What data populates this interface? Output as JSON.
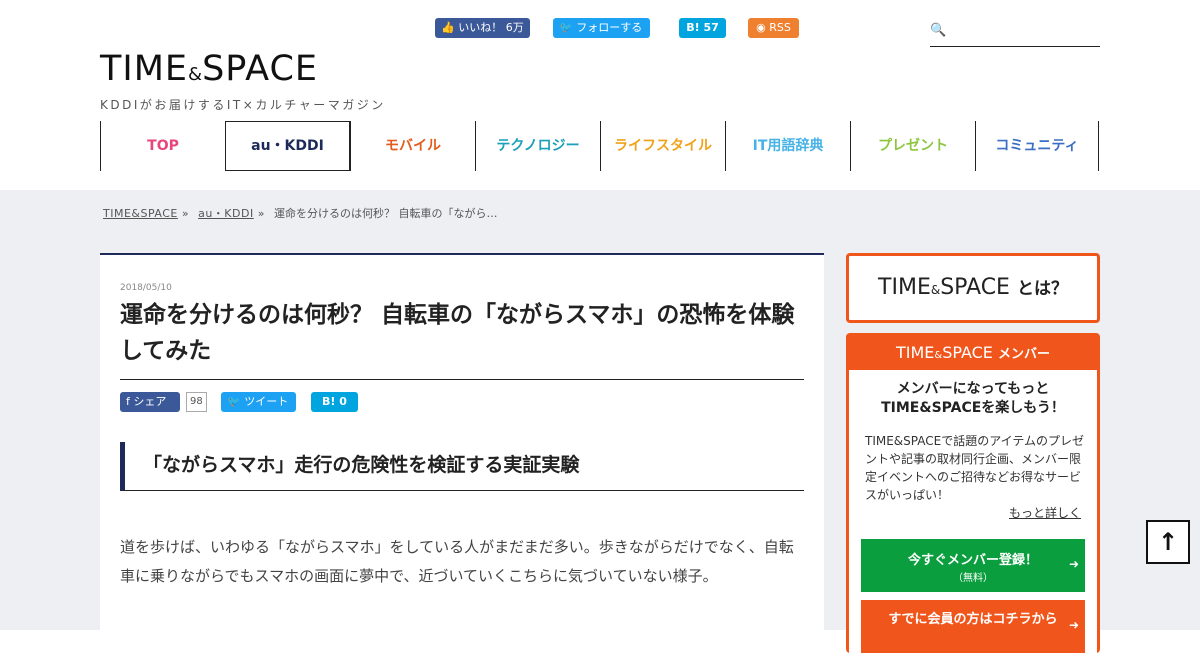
{
  "header": {
    "logo_main": "TIME",
    "logo_amp": "&",
    "logo_main2": "SPACE",
    "logo_tagline": "KDDIがお届けするIT×カルチャーマガジン",
    "social": [
      {
        "label": "👍 いいね！",
        "count": "6万",
        "color": "#3b5998"
      },
      {
        "label": "🐦 フォローする",
        "color": "#1da1f2"
      },
      {
        "label": "B! 57",
        "color": "#00a4de"
      },
      {
        "label": "RSS",
        "color": "#ee802f"
      }
    ],
    "search_placeholder": ""
  },
  "nav": [
    {
      "label": "TOP",
      "color": "#e8447d"
    },
    {
      "label": "au・KDDI",
      "color": "#1e2a5a",
      "active": true
    },
    {
      "label": "モバイル",
      "color": "#e25c1c"
    },
    {
      "label": "テクノロジー",
      "color": "#1aa0b9"
    },
    {
      "label": "ライフスタイル",
      "color": "#f0a31a"
    },
    {
      "label": "IT用語辞典",
      "color": "#47b2e6"
    },
    {
      "label": "プレゼント",
      "color": "#8cc63f"
    },
    {
      "label": "コミュニティ",
      "color": "#3b6fc4"
    }
  ],
  "breadcrumb": {
    "home": "TIME&SPACE",
    "cat": "au・KDDI",
    "current": "運命を分けるのは何秒？ 自転車の「ながら…",
    "sep": "»"
  },
  "article": {
    "date": "2018/05/10",
    "title": "運命を分けるのは何秒？ 自転車の「ながらスマホ」の恐怖を体験してみた",
    "share_fb": "f シェア",
    "share_fb_count": "98",
    "share_tw": "ツイート",
    "share_hb": "B! 0",
    "heading": "「ながらスマホ」走行の危険性を検証する実証実験",
    "body": "道を歩けば、いわゆる「ながらスマホ」をしている人がまだまだ多い。歩きながらだけでなく、自転車に乗りながらでもスマホの画面に夢中で、近づいていくこちらに気づいていない様子。"
  },
  "sidebar": {
    "about_main": "TIME",
    "about_amp": "&",
    "about_main2": "SPACE",
    "about_suffix": "とは？",
    "member_head_main": "TIME",
    "member_head_amp": "&",
    "member_head_main2": "SPACE",
    "member_head_suffix": "メンバー",
    "member_title1": "メンバーになってもっと",
    "member_title2": "TIME&SPACEを楽しもう！",
    "member_desc": "TIME&SPACEで話題のアイテムのプレゼントや記事の取材同行企画、メンバー限定イベントへのご招待などお得なサービスがいっぱい！",
    "more": "もっと詳しく",
    "register": "今すぐメンバー登録！",
    "register_sub": "（無料）",
    "login": "すでに会員の方はコチラから",
    "arrow": "➜"
  },
  "totop": "↑"
}
